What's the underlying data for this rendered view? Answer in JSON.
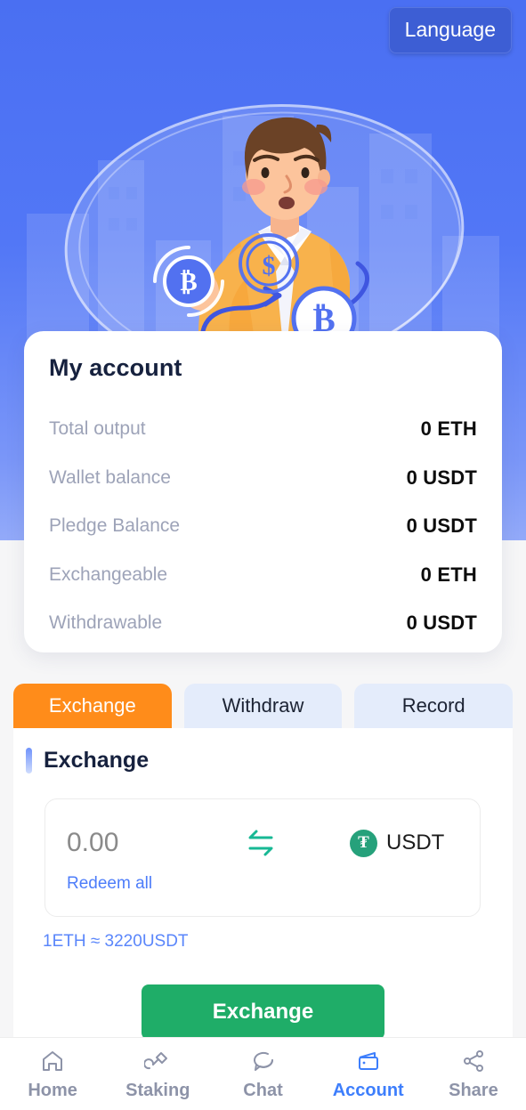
{
  "header": {
    "language_button": "Language"
  },
  "hero": {
    "alt": "man holding bitcoin coin illustration"
  },
  "account_card": {
    "title": "My account",
    "rows": [
      {
        "label": "Total output",
        "value": "0 ETH"
      },
      {
        "label": "Wallet balance",
        "value": "0 USDT"
      },
      {
        "label": "Pledge Balance",
        "value": "0 USDT"
      },
      {
        "label": "Exchangeable",
        "value": "0 ETH"
      },
      {
        "label": "Withdrawable",
        "value": "0 USDT"
      }
    ]
  },
  "tabs": [
    {
      "label": "Exchange",
      "active": true
    },
    {
      "label": "Withdraw",
      "active": false
    },
    {
      "label": "Record",
      "active": false
    }
  ],
  "exchange_panel": {
    "section_title": "Exchange",
    "amount_placeholder": "0.00",
    "redeem_all": "Redeem all",
    "currency": "USDT",
    "currency_symbol": "₮",
    "rate_text": "1ETH ≈ 3220USDT",
    "submit_label": "Exchange"
  },
  "bottom_nav": [
    {
      "label": "Home",
      "icon": "home-icon",
      "active": false
    },
    {
      "label": "Staking",
      "icon": "shovel-icon",
      "active": false
    },
    {
      "label": "Chat",
      "icon": "chat-icon",
      "active": false
    },
    {
      "label": "Account",
      "icon": "wallet-icon",
      "active": true
    },
    {
      "label": "Share",
      "icon": "share-icon",
      "active": false
    }
  ],
  "colors": {
    "hero_blue": "#4a6ff2",
    "accent_orange": "#ff8c1a",
    "accent_green": "#1fad68",
    "link_blue": "#4d7dfa",
    "usdt_green": "#26a17b",
    "nav_active": "#3d7efc"
  }
}
